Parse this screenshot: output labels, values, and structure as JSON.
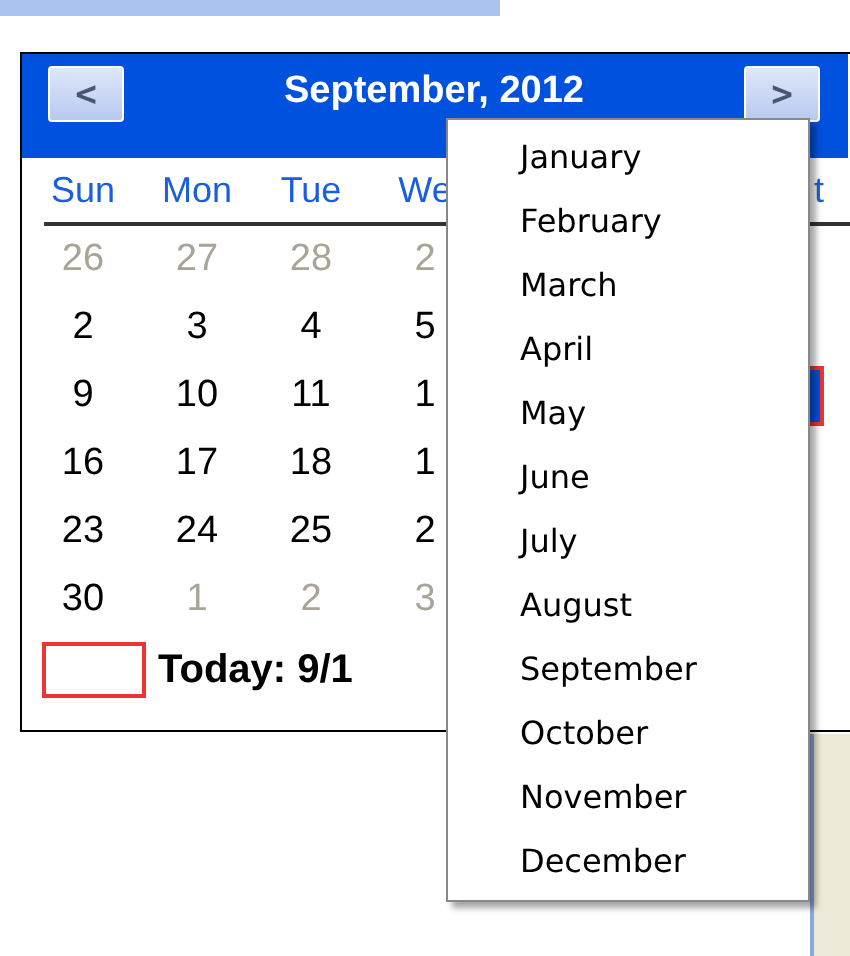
{
  "calendar": {
    "title": "September, 2012",
    "prev_label": "<",
    "next_label": ">",
    "weekdays": [
      "Sun",
      "Mon",
      "Tue",
      "We"
    ],
    "weekday_end": "t",
    "weeks": [
      {
        "days": [
          {
            "text": "26",
            "muted": true
          },
          {
            "text": "27",
            "muted": true
          },
          {
            "text": "28",
            "muted": true
          },
          {
            "text": "2",
            "muted": true
          }
        ]
      },
      {
        "days": [
          {
            "text": "2",
            "muted": false
          },
          {
            "text": "3",
            "muted": false
          },
          {
            "text": "4",
            "muted": false
          },
          {
            "text": "5",
            "muted": false
          }
        ]
      },
      {
        "days": [
          {
            "text": "9",
            "muted": false
          },
          {
            "text": "10",
            "muted": false
          },
          {
            "text": "11",
            "muted": false
          },
          {
            "text": "1",
            "muted": false
          }
        ],
        "end_selected": true
      },
      {
        "days": [
          {
            "text": "16",
            "muted": false
          },
          {
            "text": "17",
            "muted": false
          },
          {
            "text": "18",
            "muted": false
          },
          {
            "text": "1",
            "muted": false
          }
        ]
      },
      {
        "days": [
          {
            "text": "23",
            "muted": false
          },
          {
            "text": "24",
            "muted": false
          },
          {
            "text": "25",
            "muted": false
          },
          {
            "text": "2",
            "muted": false
          }
        ]
      },
      {
        "days": [
          {
            "text": "30",
            "muted": false
          },
          {
            "text": "1",
            "muted": true
          },
          {
            "text": "2",
            "muted": true
          },
          {
            "text": "3",
            "muted": true
          }
        ]
      }
    ],
    "today_label": "Today: 9/1"
  },
  "month_menu": {
    "items": [
      "January",
      "February",
      "March",
      "April",
      "May",
      "June",
      "July",
      "August",
      "September",
      "October",
      "November",
      "December"
    ]
  }
}
